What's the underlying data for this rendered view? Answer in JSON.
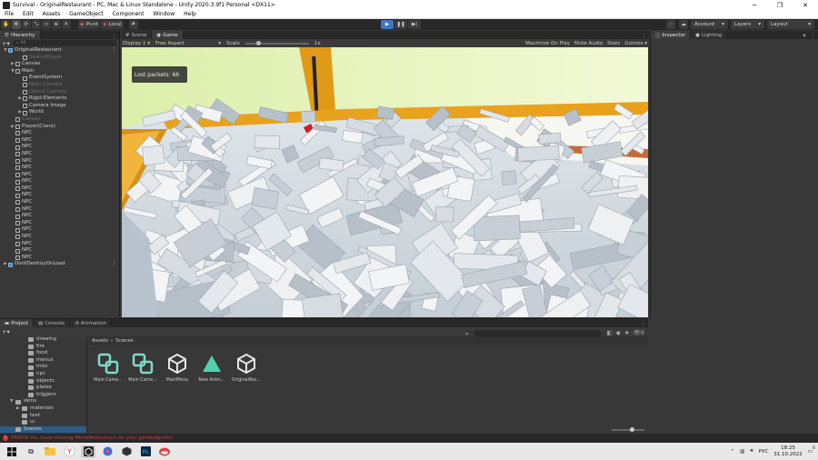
{
  "window": {
    "title": "Survival - OriginalRestaurant - PC, Mac & Linux Standalone - Unity 2020.3.9f1 Personal <DX11>",
    "minimize": "─",
    "maximize": "❐",
    "close": "✕"
  },
  "menu": [
    "File",
    "Edit",
    "Assets",
    "GameObject",
    "Component",
    "Window",
    "Help"
  ],
  "toolbar": {
    "pivot": "Pivot",
    "local": "Local",
    "account": "Account",
    "layers": "Layers",
    "layout": "Layout"
  },
  "hierarchy": {
    "tab": "Hierarchy",
    "search_placeholder": "All",
    "items": [
      {
        "label": "OriginalRestaurant",
        "indent": 0,
        "arrow": "▼",
        "dim": false,
        "selected": false,
        "scene": true
      },
      {
        "label": "SearchPlayer",
        "indent": 2,
        "arrow": "",
        "dim": true,
        "selected": false
      },
      {
        "label": "Canvas",
        "indent": 1,
        "arrow": "▶",
        "dim": false,
        "selected": false
      },
      {
        "label": "Main",
        "indent": 1,
        "arrow": "▼",
        "dim": false,
        "selected": false
      },
      {
        "label": "EventSystem",
        "indent": 2,
        "arrow": "",
        "dim": false,
        "selected": false
      },
      {
        "label": "Main Camera",
        "indent": 2,
        "arrow": "",
        "dim": true,
        "selected": false
      },
      {
        "label": "Object Camera",
        "indent": 2,
        "arrow": "",
        "dim": true,
        "selected": false
      },
      {
        "label": "Rigid-Elements",
        "indent": 2,
        "arrow": "▶",
        "dim": false,
        "selected": false
      },
      {
        "label": "Camera Image",
        "indent": 2,
        "arrow": "",
        "dim": false,
        "selected": false
      },
      {
        "label": "World",
        "indent": 2,
        "arrow": "▶",
        "dim": false,
        "selected": false
      },
      {
        "label": "Canvas",
        "indent": 1,
        "arrow": "",
        "dim": true,
        "selected": false
      },
      {
        "label": "Player(Clone)",
        "indent": 1,
        "arrow": "▶",
        "dim": false,
        "selected": false
      },
      {
        "label": "NPC",
        "indent": 1,
        "arrow": "",
        "dim": false,
        "selected": false
      },
      {
        "label": "NPC",
        "indent": 1,
        "arrow": "",
        "dim": false,
        "selected": false
      },
      {
        "label": "NPC",
        "indent": 1,
        "arrow": "",
        "dim": false,
        "selected": false
      },
      {
        "label": "NPC",
        "indent": 1,
        "arrow": "",
        "dim": false,
        "selected": false
      },
      {
        "label": "NPC",
        "indent": 1,
        "arrow": "",
        "dim": false,
        "selected": false
      },
      {
        "label": "NPC",
        "indent": 1,
        "arrow": "",
        "dim": false,
        "selected": false
      },
      {
        "label": "NPC",
        "indent": 1,
        "arrow": "",
        "dim": false,
        "selected": false
      },
      {
        "label": "NPC",
        "indent": 1,
        "arrow": "",
        "dim": false,
        "selected": false
      },
      {
        "label": "NPC",
        "indent": 1,
        "arrow": "",
        "dim": false,
        "selected": false
      },
      {
        "label": "NPC",
        "indent": 1,
        "arrow": "",
        "dim": false,
        "selected": false
      },
      {
        "label": "NPC",
        "indent": 1,
        "arrow": "",
        "dim": false,
        "selected": false
      },
      {
        "label": "NPC",
        "indent": 1,
        "arrow": "",
        "dim": false,
        "selected": false
      },
      {
        "label": "NPC",
        "indent": 1,
        "arrow": "",
        "dim": false,
        "selected": false
      },
      {
        "label": "NPC",
        "indent": 1,
        "arrow": "",
        "dim": false,
        "selected": false
      },
      {
        "label": "NPC",
        "indent": 1,
        "arrow": "",
        "dim": false,
        "selected": false
      },
      {
        "label": "NPC",
        "indent": 1,
        "arrow": "",
        "dim": false,
        "selected": false
      },
      {
        "label": "NPC",
        "indent": 1,
        "arrow": "",
        "dim": false,
        "selected": false
      },
      {
        "label": "NPC",
        "indent": 1,
        "arrow": "",
        "dim": false,
        "selected": false
      },
      {
        "label": "NPC",
        "indent": 1,
        "arrow": "",
        "dim": false,
        "selected": false
      },
      {
        "label": "DontDestroyOnLoad",
        "indent": 0,
        "arrow": "▶",
        "dim": false,
        "selected": false,
        "scene": true
      }
    ]
  },
  "game": {
    "tab_scene": "Scene",
    "tab_game": "Game",
    "display": "Display 1",
    "aspect": "Free Aspect",
    "scale_label": "Scale",
    "scale_value": "1x",
    "maximize_on_play": "Maximize On Play",
    "mute_audio": "Mute Audio",
    "stats": "Stats",
    "gizmos": "Gizmos",
    "overlay_text": "Lost packets: 66"
  },
  "inspector": {
    "tab_inspector": "Inspector",
    "tab_lighting": "Lighting"
  },
  "project": {
    "tab_project": "Project",
    "tab_console": "Console",
    "tab_animation": "Animation",
    "badge_count": "9",
    "folders": [
      {
        "label": "drawing",
        "indent": 3
      },
      {
        "label": "fire",
        "indent": 3
      },
      {
        "label": "food",
        "indent": 3
      },
      {
        "label": "menus",
        "indent": 3
      },
      {
        "label": "misc",
        "indent": 3
      },
      {
        "label": "npc",
        "indent": 3
      },
      {
        "label": "objects",
        "indent": 3
      },
      {
        "label": "plates",
        "indent": 3
      },
      {
        "label": "triggers",
        "indent": 3
      },
      {
        "label": "skins",
        "indent": 1,
        "arrow": "▼"
      },
      {
        "label": "materials",
        "indent": 2,
        "arrow": "▶"
      },
      {
        "label": "text",
        "indent": 2
      },
      {
        "label": "ui",
        "indent": 2
      },
      {
        "label": "Scenes",
        "indent": 1,
        "selected": true
      }
    ],
    "breadcrumb": [
      "Assets",
      "Scenes"
    ],
    "assets": [
      {
        "label": "Main Came...",
        "icon": "prefab-icon"
      },
      {
        "label": "Main Came...",
        "icon": "prefab-icon"
      },
      {
        "label": "MainMenu",
        "icon": "unity-scene-icon"
      },
      {
        "label": "New Anim...",
        "icon": "animation-icon"
      },
      {
        "label": "OriginalRes...",
        "icon": "unity-scene-icon"
      }
    ]
  },
  "status": {
    "error": "ERROR You have missing MonoBehaviours on your gameobjects!"
  },
  "taskbar": {
    "lang": "РУС",
    "time": "18:25",
    "date": "31.10.2022",
    "notif_count": "6"
  },
  "colors": {
    "accent": "#3a78c2",
    "selection": "#2c5d87",
    "error": "#d33333",
    "floor_orange": "#e8a21c",
    "wall_green": "#e3f2b4"
  }
}
